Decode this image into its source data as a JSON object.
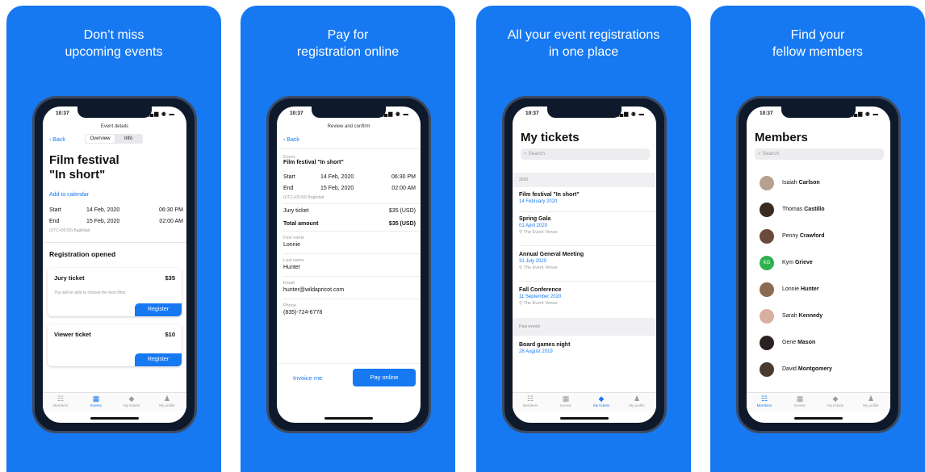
{
  "panels": [
    {
      "caption": [
        "Don’t miss",
        "upcoming events"
      ],
      "status_time": "10:37",
      "nav_title": "Event details",
      "back": "Back",
      "tabs_seg": [
        "Overview",
        "Info"
      ],
      "event_title": [
        "Film festival",
        "\"In short\""
      ],
      "add_calendar": "Add to calendar",
      "start_label": "Start",
      "start_date": "14 Feb, 2020",
      "start_time": "06:30 PM",
      "end_label": "End",
      "end_date": "15 Feb, 2020",
      "end_time": "02:00 AM",
      "timezone": "(UTC+03:00) Baghdad",
      "reg_heading": "Registration opened",
      "ticket1_name": "Jury ticket",
      "ticket1_price": "$35",
      "ticket1_note": "You will be able to choose the best films",
      "register_label": "Register",
      "ticket2_name": "Viewer ticket",
      "ticket2_price": "$10"
    },
    {
      "caption": [
        "Pay for",
        "registration online"
      ],
      "status_time": "10:37",
      "nav_title": "Review and confirm",
      "back": "Back",
      "event_label": "Event",
      "event_name": "Film festival \"In short\"",
      "start_label": "Start",
      "start_date": "14 Feb, 2020",
      "start_time": "06:30 PM",
      "end_label": "End",
      "end_date": "15 Feb, 2020",
      "end_time": "02:00 AM",
      "timezone": "(UTC+03:00) Baghdad",
      "jury_label": "Jury ticket",
      "jury_price": "$35 (USD)",
      "total_label": "Total amount",
      "total_price": "$35 (USD)",
      "first_label": "First name",
      "first_value": "Lonnie",
      "last_label": "Last name",
      "last_value": "Hunter",
      "email_label": "Email",
      "email_value": "hunter@wildapricot.com",
      "phone_label": "Phone",
      "phone_value": "(835)-724-6778",
      "invoice_label": "Invoice me",
      "pay_label": "Pay online"
    },
    {
      "caption": [
        "All your event registrations",
        "in one place"
      ],
      "status_time": "10:37",
      "title": "My tickets",
      "search_placeholder": "Search",
      "section_year": "2020",
      "tickets": [
        {
          "title": "Film festival \"In short\"",
          "date": "14 February 2020",
          "venue": ""
        },
        {
          "title": "Spring Gala",
          "date": "01 April 2020",
          "venue": "The Event Venue"
        },
        {
          "title": "Annual General Meeting",
          "date": "31 July 2020",
          "venue": "The Event Venue"
        },
        {
          "title": "Fall Conference",
          "date": "11 September 2020",
          "venue": "The Event Venue"
        }
      ],
      "section_past": "Past events",
      "past_title": "Board games night",
      "past_date": "28 August 2019"
    },
    {
      "caption": [
        "Find your",
        "fellow members"
      ],
      "status_time": "10:37",
      "title": "Members",
      "search_placeholder": "Search",
      "members": [
        {
          "first": "Isaiah",
          "last": "Carlson",
          "initials": ""
        },
        {
          "first": "Thomas",
          "last": "Castillo",
          "initials": ""
        },
        {
          "first": "Penny",
          "last": "Crawford",
          "initials": ""
        },
        {
          "first": "Kym",
          "last": "Grieve",
          "initials": "KG"
        },
        {
          "first": "Lonnie",
          "last": "Hunter",
          "initials": ""
        },
        {
          "first": "Sarah",
          "last": "Kennedy",
          "initials": ""
        },
        {
          "first": "Gene",
          "last": "Mason",
          "initials": ""
        },
        {
          "first": "David",
          "last": "Montgomery",
          "initials": ""
        }
      ]
    }
  ],
  "tabbar": [
    "Members",
    "Events",
    "My tickets",
    "My profile"
  ],
  "colors": {
    "accent": "#1779f2",
    "panel_bg": "#1779f2",
    "kg_avatar": "#2fb050"
  }
}
